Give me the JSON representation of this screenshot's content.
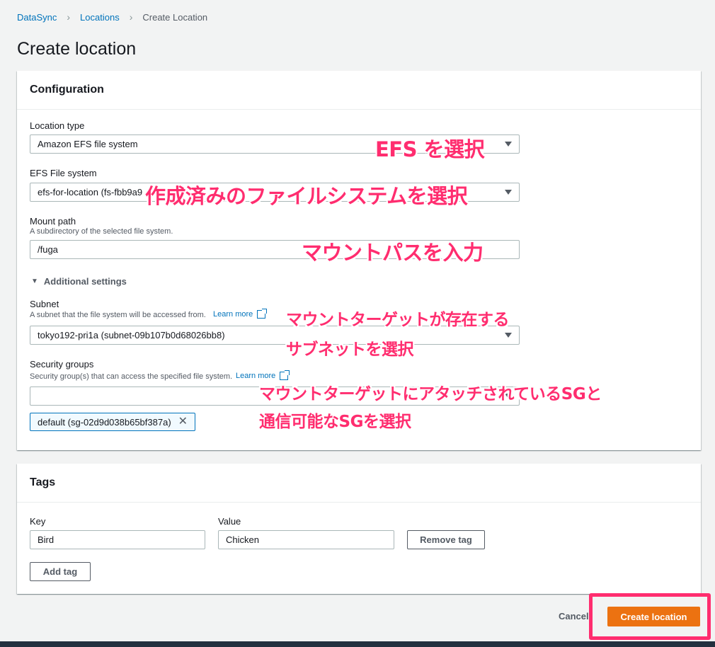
{
  "breadcrumb": {
    "items": [
      "DataSync",
      "Locations"
    ],
    "current": "Create Location"
  },
  "page_title": "Create location",
  "configuration": {
    "header": "Configuration",
    "location_type": {
      "label": "Location type",
      "value": "Amazon EFS file system"
    },
    "efs_file_system": {
      "label": "EFS File system",
      "value": "efs-for-location (fs-fbb9a9"
    },
    "mount_path": {
      "label": "Mount path",
      "description": "A subdirectory of the selected file system.",
      "value": "/fuga"
    },
    "additional_settings": "Additional settings",
    "subnet": {
      "label": "Subnet",
      "description": "A subnet that the file system will be accessed from.",
      "learn_more": "Learn more",
      "value": "tokyo192-pri1a (subnet-09b107b0d68026bb8)"
    },
    "security_groups": {
      "label": "Security groups",
      "description": "Security group(s) that can access the specified file system.",
      "learn_more": "Learn more",
      "value": "",
      "token": "default (sg-02d9d038b65bf387a)"
    }
  },
  "tags": {
    "header": "Tags",
    "key_label": "Key",
    "value_label": "Value",
    "key_value": "Bird",
    "value_value": "Chicken",
    "remove_tag": "Remove tag",
    "add_tag": "Add tag"
  },
  "footer": {
    "cancel": "Cancel",
    "create": "Create location"
  },
  "annotations": {
    "efs": "EFS を選択",
    "filesystem": "作成済みのファイルシステムを選択",
    "mountpath": "マウントパスを入力",
    "subnet_line1": "マウントターゲットが存在する",
    "subnet_line2": "サブネットを選択",
    "sg_line1": "マウントターゲットにアタッチされているSGと",
    "sg_line2": "通信可能なSGを選択"
  },
  "colors": {
    "accent": "#0073bb",
    "primary": "#ec7211",
    "annotation": "#ff2d6f"
  }
}
